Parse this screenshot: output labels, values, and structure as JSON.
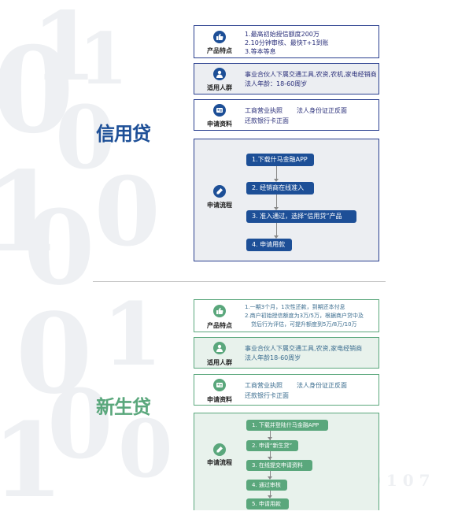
{
  "colors": {
    "blue": "#1d4f97",
    "blue_border": "#2a3f8f",
    "green": "#5aa77c",
    "green_border": "#5aa77c"
  },
  "xinyongdai": {
    "title": "信用贷",
    "features": {
      "label": "产品特点",
      "icon": "thumbs-up-icon",
      "lines": [
        "1.最高初始授信额度200万",
        "2.10分钟审核、最快T+1到账",
        "3.等本等息"
      ]
    },
    "users": {
      "label": "适用人群",
      "icon": "person-icon",
      "lines": [
        "事业合伙人下属交通工具,农资,农机,家电经销商",
        "法人年龄：18-60周岁"
      ]
    },
    "materials": {
      "label": "申请资料",
      "icon": "id-card-icon",
      "line1a": "工商营业执照",
      "line1b": "法人身份证正反面",
      "line2": "还款银行卡正面"
    },
    "process": {
      "label": "申请流程",
      "icon": "pen-icon",
      "steps": [
        "1.下载什马金融APP",
        "2. 经销商在线准入",
        "3. 准入通过，选择“信用贷”产品",
        "4. 申请用款"
      ]
    }
  },
  "xinshengdai": {
    "title": "新生贷",
    "features": {
      "label": "产品特点",
      "icon": "thumbs-up-icon",
      "lines": [
        "1.一期3个月，1次性还款，到期还本付息",
        "2.商户初始授信额度为3万/5万，根据商户贷中及",
        "贷后行为评估，可提升额度到5万/8万/10万"
      ]
    },
    "users": {
      "label": "适用人群",
      "icon": "person-icon",
      "lines": [
        "事业合伙人下属交通工具,农资,家电经销商",
        "法人年龄18-60周岁"
      ]
    },
    "materials": {
      "label": "申请资料",
      "icon": "id-card-icon",
      "line1a": "工商营业执照",
      "line1b": "法人身份证正反面",
      "line2": "还款银行卡正面"
    },
    "process": {
      "label": "申请流程",
      "icon": "pen-icon",
      "steps": [
        "1. 下载并登陆什马金融APP",
        "2. 申请“新生贷”",
        "3. 在线提交申请资料",
        "4. 通过审核",
        "5. 申请用款"
      ]
    }
  }
}
